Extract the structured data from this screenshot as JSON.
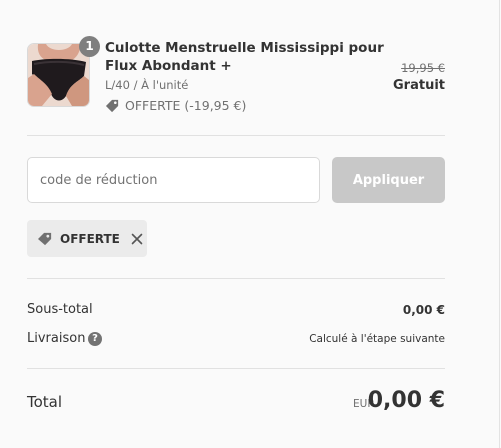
{
  "order_summary": {
    "product": {
      "quantity": "1",
      "title": "Culotte Menstruelle Mississippi pour Flux Abondant +",
      "variant": "L/40 / À l'unité",
      "discount_label": "OFFERTE (-19,95 €)",
      "original_price": "19,95 €",
      "final_price": "Gratuit"
    },
    "discount": {
      "placeholder": "code de réduction",
      "value": "",
      "apply_label": "Appliquer",
      "applied_tag": "OFFERTE"
    },
    "totals": {
      "subtotal_label": "Sous-total",
      "subtotal_value": "0,00 €",
      "shipping_label": "Livraison",
      "shipping_help": "?",
      "shipping_value": "Calculé à l'étape suivante",
      "total_label": "Total",
      "currency": "EUR",
      "total_value": "0,00 €"
    }
  },
  "colors": {
    "background": "#fafafa",
    "button_disabled": "#c8c8c8",
    "chip_background": "#ebebeb",
    "badge": "#7f7f7f",
    "muted_text": "#707070"
  },
  "icons": {
    "product_image": "menstrual-underwear-photo",
    "discount": "tag-icon",
    "remove": "close-icon",
    "help": "question-circle-icon"
  }
}
